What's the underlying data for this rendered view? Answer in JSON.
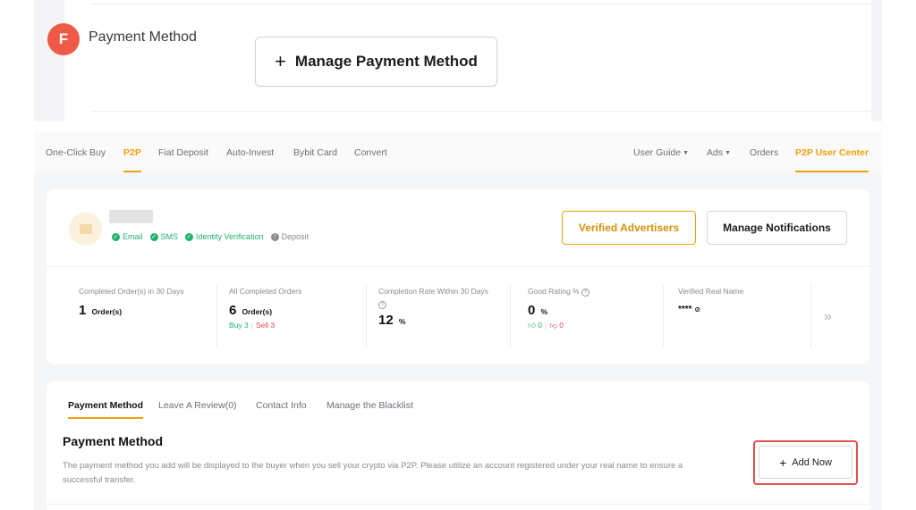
{
  "step": {
    "badge": "F",
    "title": "Payment Method",
    "button_label": "Manage Payment Method",
    "button_icon": "plus-icon"
  },
  "nav": {
    "left": [
      "One-Click Buy",
      "P2P",
      "Fiat Deposit",
      "Auto-Invest",
      "Bybit Card",
      "Convert"
    ],
    "right": [
      "User Guide",
      "Ads",
      "Orders",
      "P2P User Center"
    ],
    "active_left": "P2P",
    "active_right": "P2P User Center",
    "dropdown_icon": "caret-down-icon",
    "accent_color": "#f0a10c"
  },
  "profile": {
    "verifications": [
      {
        "label": "Email",
        "status": "verified"
      },
      {
        "label": "SMS",
        "status": "verified"
      },
      {
        "label": "Identity Verification",
        "status": "verified"
      },
      {
        "label": "Deposit",
        "status": "not-verified"
      }
    ],
    "verified_advertisers_label": "Verified Advertisers",
    "manage_notifications_label": "Manage Notifications"
  },
  "stats": {
    "completed_30": {
      "label": "Completed Order(s) in 30 Days",
      "value": "1",
      "unit": "Order(s)"
    },
    "all_completed": {
      "label": "All Completed Orders",
      "value": "6",
      "unit": "Order(s)",
      "buy": "Buy 3",
      "sell": "Sell 3"
    },
    "completion_rate": {
      "label": "Completion Rate Within 30 Days",
      "value": "12",
      "unit": "%"
    },
    "good_rating": {
      "label": "Good Rating %",
      "value": "0",
      "unit": "%",
      "thumbs_up": "0",
      "thumbs_down": "0"
    },
    "real_name": {
      "label": "Verified Real Name",
      "value": "****"
    },
    "more_icon": "double-chevron-right-icon"
  },
  "tabs": [
    "Payment Method",
    "Leave A Review(0)",
    "Contact Info",
    "Manage the Blacklist"
  ],
  "payment_section": {
    "title": "Payment Method",
    "description": "The payment method you add will be displayed to the buyer when you sell your crypto via P2P. Please utilize an account registered under your real name to ensure a successful transfer.",
    "add_button": "Add Now",
    "highlight_color": "#e05050"
  }
}
